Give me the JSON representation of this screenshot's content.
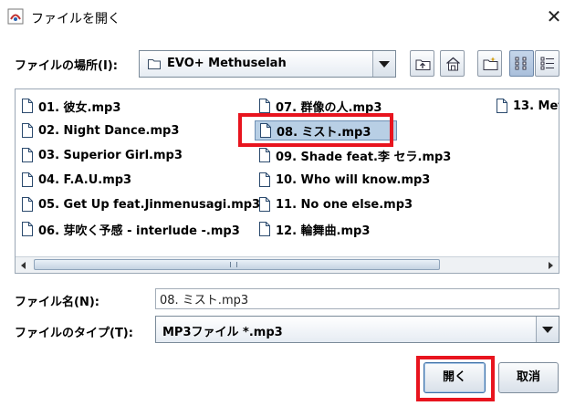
{
  "window": {
    "title": "ファイルを開く",
    "close_glyph": "✕"
  },
  "lookin": {
    "label": "ファイルの場所(I):",
    "value": "EVO+ Methuselah"
  },
  "toolbar": {
    "icons": [
      "up-folder-icon",
      "home-icon",
      "new-folder-icon",
      "list-view-icon",
      "details-view-icon"
    ]
  },
  "files": [
    "01. 彼女.mp3",
    "02. Night Dance.mp3",
    "03. Superior Girl.mp3",
    "04. F.A.U.mp3",
    "05. Get Up feat.Jinmenusagi.mp3",
    "06. 芽吹く予感 - interlude -.mp3",
    "07. 群像の人.mp3",
    "08. ミスト.mp3",
    "09. Shade feat.李 セラ.mp3",
    "10. Who will know.mp3",
    "11. No one else.mp3",
    "12. 輪舞曲.mp3",
    "13. Met"
  ],
  "selected_file_index": 7,
  "filename": {
    "label": "ファイル名(N):",
    "value": "08. ミスト.mp3"
  },
  "filetype": {
    "label": "ファイルのタイプ(T):",
    "value": "MP3ファイル *.mp3"
  },
  "buttons": {
    "open": "開く",
    "cancel": "取消"
  },
  "colors": {
    "selection": "#b8cfe5",
    "highlight": "#e8141e"
  }
}
